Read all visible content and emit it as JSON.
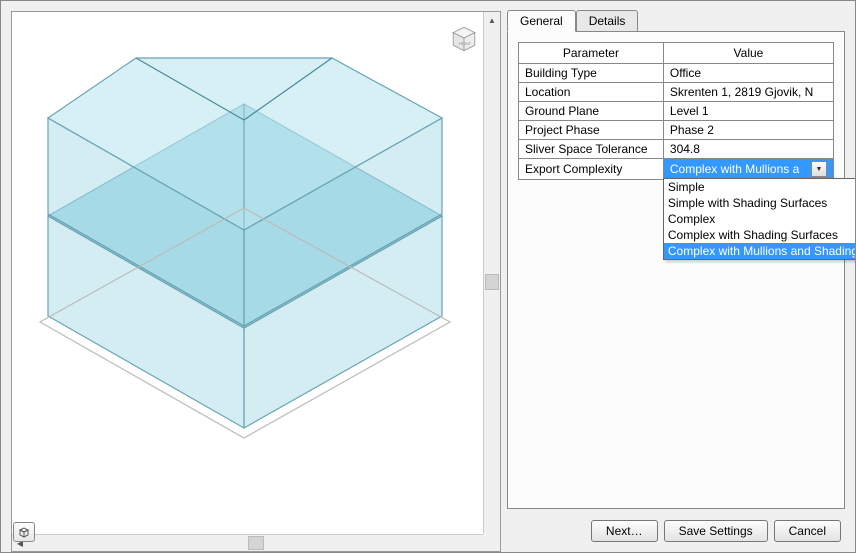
{
  "tabs": {
    "general": "General",
    "details": "Details"
  },
  "table": {
    "header_parameter": "Parameter",
    "header_value": "Value",
    "rows": [
      {
        "param": "Building Type",
        "value": "Office"
      },
      {
        "param": "Location",
        "value": "Skrenten 1, 2819 Gjovik, N"
      },
      {
        "param": "Ground Plane",
        "value": "Level 1"
      },
      {
        "param": "Project Phase",
        "value": "Phase 2"
      },
      {
        "param": "Sliver Space Tolerance",
        "value": "304.8"
      }
    ],
    "dropdown_row": {
      "param": "Export Complexity",
      "selected_display": "Complex with Mullions a",
      "options": [
        "Simple",
        "Simple with Shading Surfaces",
        "Complex",
        "Complex with Shading Surfaces",
        "Complex with Mullions and Shading"
      ],
      "highlighted_index": 4
    }
  },
  "buttons": {
    "next": "Next…",
    "save": "Save Settings",
    "cancel": "Cancel"
  },
  "viewcube": {
    "face": "FRONT"
  }
}
